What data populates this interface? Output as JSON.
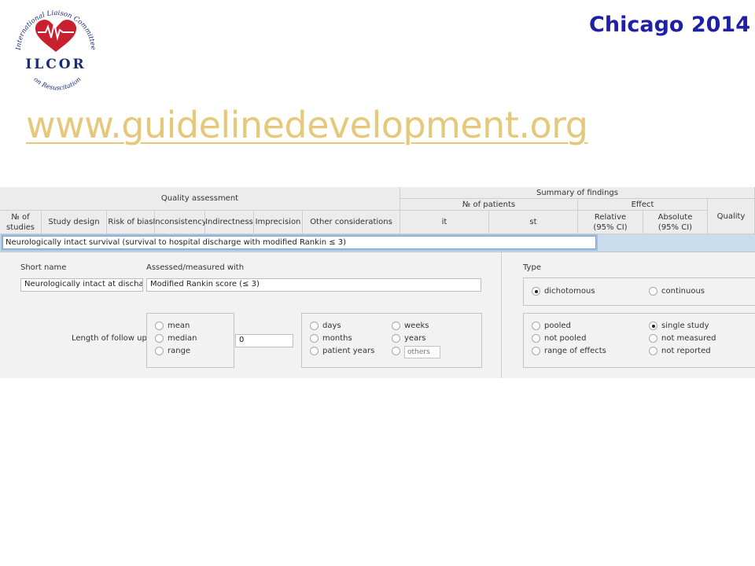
{
  "header": {
    "conference": "Chicago 2014",
    "url": "www.guidelinedevelopment.org"
  },
  "logo": {
    "text_arc": "International Liaison Committee",
    "text_main": "ILCOR",
    "text_bottom": "on Resuscitation",
    "colors": {
      "heart": "#c8202f",
      "text": "#1a2a7a",
      "arc": "#c8202f"
    }
  },
  "table_header": {
    "quality_assessment": "Quality assessment",
    "summary_of_findings": "Summary of findings",
    "num_patients": "№ of patients",
    "effect": "Effect",
    "columns": {
      "num_studies": "№ of studies",
      "study_design": "Study design",
      "risk_of_bias": "Risk of bias",
      "inconsistency": "Inconsistency",
      "indirectness": "Indirectness",
      "imprecision": "Imprecision",
      "other_considerations": "Other considerations",
      "it": "it",
      "st": "st",
      "relative": "Relative (95% CI)",
      "absolute": "Absolute (95% CI)",
      "quality": "Quality"
    }
  },
  "outcome": {
    "value": "Neurologically intact survival (survival to hospital discharge with modified Rankin ≤ 3)"
  },
  "form": {
    "short_name_label": "Short name",
    "short_name_value": "Neurologically intact at discharg",
    "assessed_label": "Assessed/measured with",
    "assessed_value": "Modified Rankin score (≤ 3)",
    "follow_up_label": "Length of follow up",
    "follow_up_value": "0",
    "stat_options": [
      "mean",
      "median",
      "range"
    ],
    "unit_options_left": [
      "days",
      "months",
      "patient years"
    ],
    "unit_options_right": [
      "weeks",
      "years"
    ],
    "others_placeholder": "others"
  },
  "type_panel": {
    "label": "Type",
    "type_options": [
      "dichotomous",
      "continuous"
    ],
    "type_selected": "dichotomous",
    "pooling_left": [
      "pooled",
      "not pooled",
      "range of effects"
    ],
    "pooling_right": [
      "single study",
      "not measured",
      "not reported"
    ],
    "pooling_selected": "single study"
  },
  "colors": {
    "title_blue": "#1f1fa8",
    "link_gold": "#e6c87a",
    "outcome_row_bg": "#c9ddef"
  }
}
